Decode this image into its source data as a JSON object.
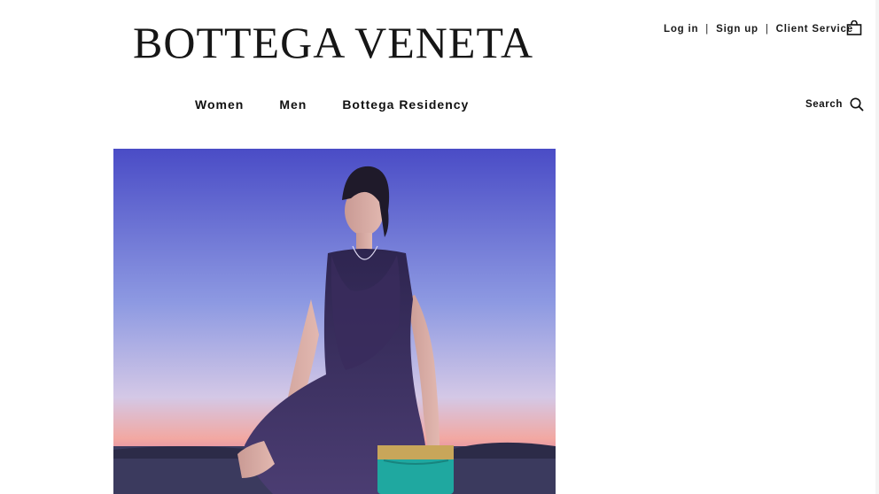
{
  "brand": {
    "logo_text": "BOTTEGA VENETA"
  },
  "account": {
    "login_label": "Log in",
    "signup_label": "Sign up",
    "client_service_label": "Client Service",
    "separator": "|",
    "bag_icon": "shopping-bag-icon"
  },
  "nav": {
    "items": [
      "Women",
      "Men",
      "Bottega Residency"
    ]
  },
  "search": {
    "label": "Search",
    "icon": "magnifier-icon"
  },
  "hero": {
    "description_icon": "campaign-photo",
    "colors": {
      "sky_top": "#4b4fc8",
      "sky_mid": "#9aa6e6",
      "horizon": "#f0a6a0",
      "sea": "#3d3a5c",
      "dress": "#3b2e5e",
      "bag": "#1fa8a0"
    }
  }
}
